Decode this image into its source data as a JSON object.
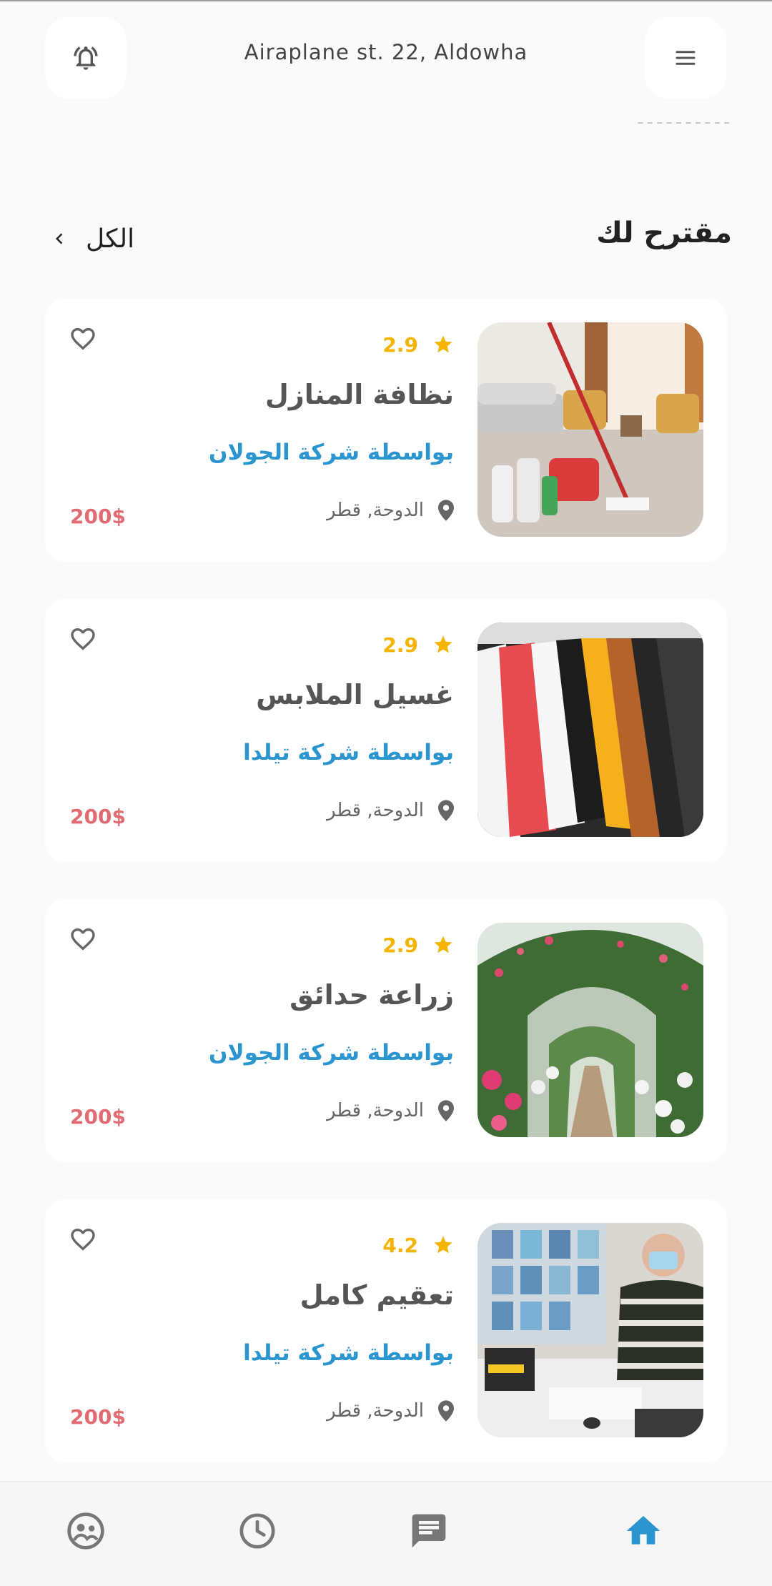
{
  "header": {
    "address": "Airaplane st. 22, Aldowha",
    "bell_icon": "bell-ring-icon",
    "menu_icon": "hamburger-menu-icon"
  },
  "section": {
    "title": "مقترح لك",
    "see_all_label": "الكل"
  },
  "services": [
    {
      "rating": "2.9",
      "title": "نظافة المنازل",
      "company": "بواسطة شركة الجولان",
      "location": "الدوحة, قطر",
      "price": "200$",
      "image": "living-room-cleaning"
    },
    {
      "rating": "2.9",
      "title": "غسيل الملابس",
      "company": "بواسطة شركة تيلدا",
      "location": "الدوحة, قطر",
      "price": "200$",
      "image": "clothes-rack"
    },
    {
      "rating": "2.9",
      "title": "زراعة حدائق",
      "company": "بواسطة شركة الجولان",
      "location": "الدوحة, قطر",
      "price": "200$",
      "image": "garden-arch"
    },
    {
      "rating": "4.2",
      "title": "تعقيم كامل",
      "company": "بواسطة شركة تيلدا",
      "location": "الدوحة, قطر",
      "price": "200$",
      "image": "disinfection-worker"
    }
  ],
  "bottom_nav": [
    {
      "name": "profile",
      "icon": "profile-icon",
      "active": false
    },
    {
      "name": "history",
      "icon": "clock-icon",
      "active": false
    },
    {
      "name": "messages",
      "icon": "chat-icon",
      "active": false
    },
    {
      "name": "home",
      "icon": "home-icon",
      "active": true
    }
  ],
  "colors": {
    "accent": "#2b95cf",
    "price": "#e06b70",
    "rating": "#f4b400",
    "icon_inactive": "#777777"
  }
}
